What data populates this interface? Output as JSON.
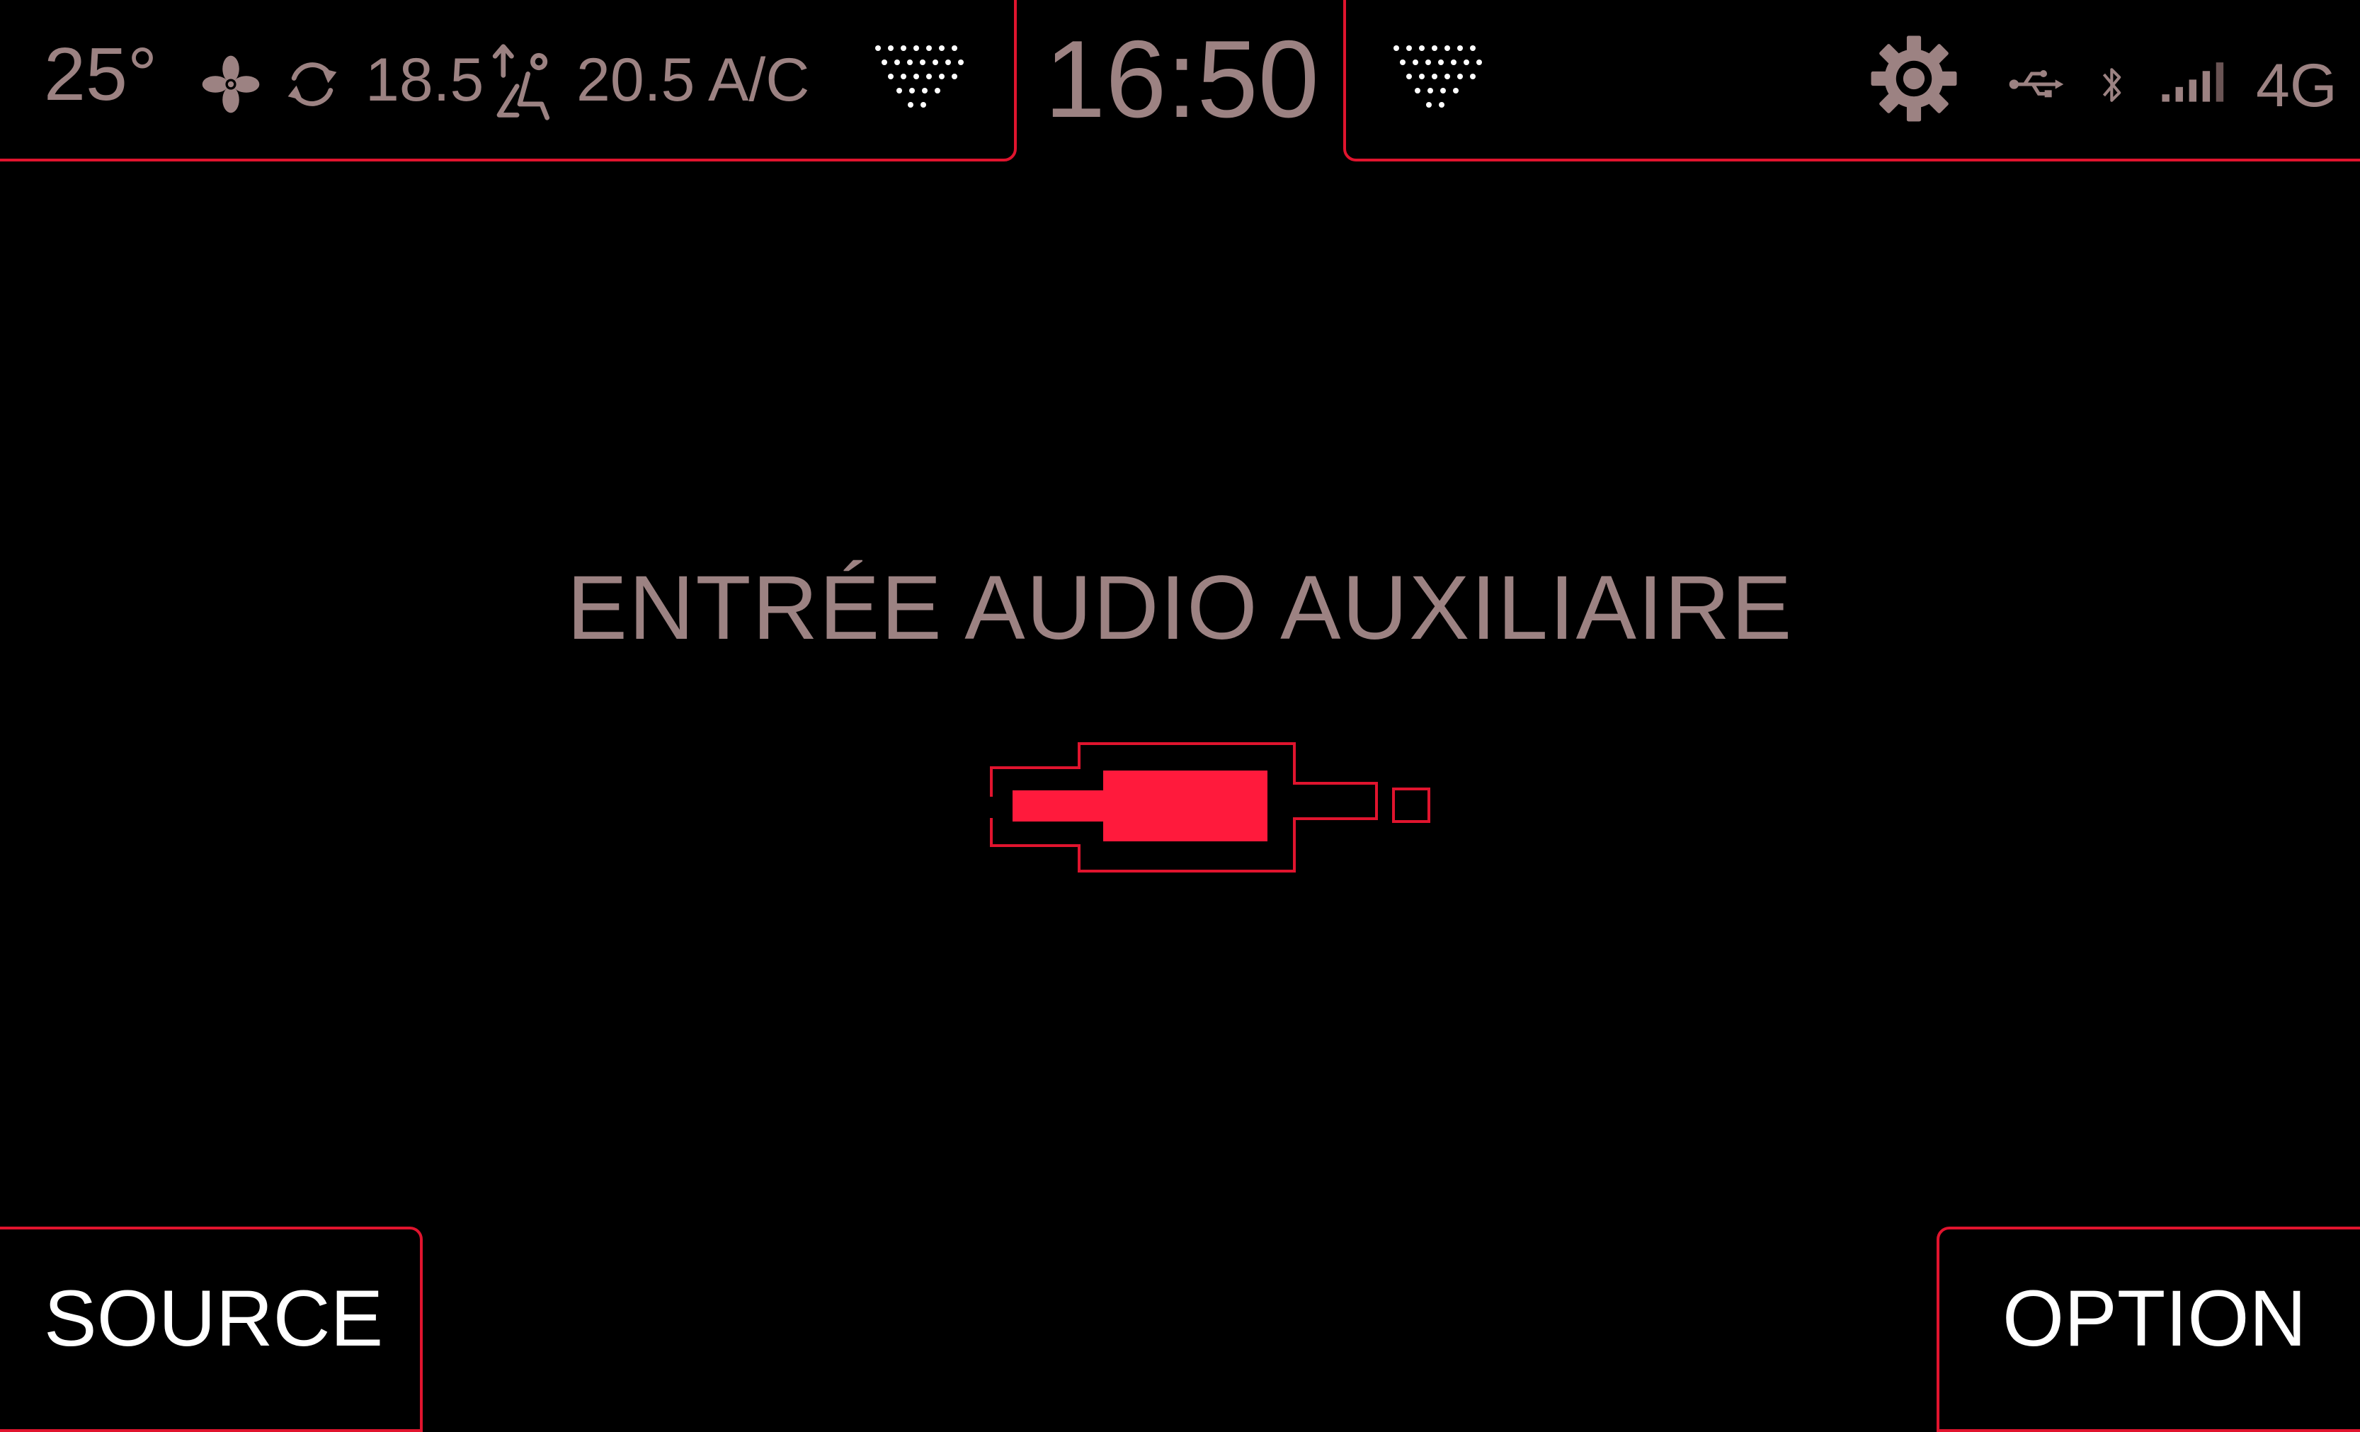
{
  "status_bar": {
    "temperature": "25°",
    "fan_icon": "fan-icon",
    "recirculation_icon": "recirculation-icon",
    "left_setpoint": "18.5",
    "seat_airflow_icon": "seat-airflow-icon",
    "right_setpoint": "20.5",
    "ac_label": "A/C",
    "clock": "16:50",
    "settings_icon": "gear-icon",
    "usb_icon": "usb-icon",
    "bluetooth_icon": "bluetooth-icon",
    "signal_icon": "signal-bars-icon",
    "network_label": "4G"
  },
  "main": {
    "title": "ENTRÉE AUDIO AUXILIAIRE",
    "illustration": "aux-jack-icon"
  },
  "bottom_bar": {
    "source_label": "SOURCE",
    "option_label": "OPTION"
  },
  "colors": {
    "background": "#000000",
    "accent_red": "#e0142e",
    "plug_fill": "#ff1a3c",
    "text_muted": "#9c8282",
    "text_white": "#ffffff"
  }
}
